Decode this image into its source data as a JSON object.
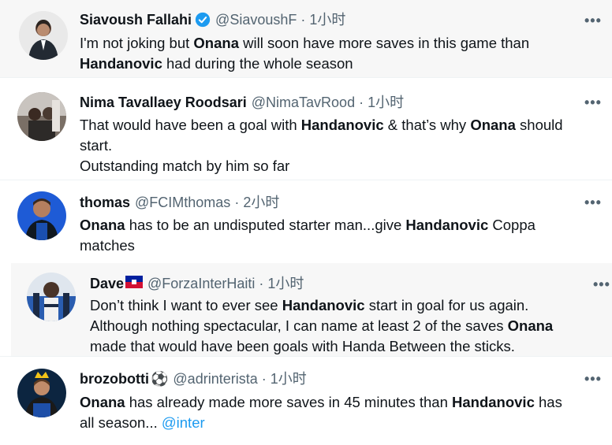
{
  "tweets": [
    {
      "name": "Siavoush Fallahi",
      "handle": "@SiavoushF",
      "time": "1小时",
      "text": {
        "a": "I'm not joking but ",
        "b": "Onana",
        "c": " will soon have more saves in this game than",
        "d": "Handanovic",
        "e": " had during the whole season"
      }
    },
    {
      "name": "Nima Tavallaey Roodsari",
      "handle": "@NimaTavRood",
      "time": "1小时",
      "text": {
        "a": "That would have been a goal with ",
        "b": "Handanovic",
        "c": " & that’s why ",
        "d": "Onana",
        "e": " should",
        "f": "start.",
        "g": "Outstanding match by him so far"
      }
    },
    {
      "name": "thomas",
      "handle": "@FCIMthomas",
      "time": "2小时",
      "text": {
        "a": "Onana",
        "b": " has to be an undisputed starter man...give ",
        "c": "Handanovic",
        "d": " Coppa",
        "e": "matches"
      }
    },
    {
      "name": "Dave",
      "flag": "🇭🇹",
      "handle": "@ForzaInterHaiti",
      "time": "1小时",
      "text": {
        "a": "Don’t think I want to ever see ",
        "b": "Handanovic",
        "c": " start in goal for us again.",
        "d": "Although nothing spectacular, I can name at least 2 of the saves ",
        "e": "Onana",
        "f": "made that would have been goals with Handa Between the sticks."
      }
    },
    {
      "name": "brozobotti",
      "emoji": "⚽",
      "handle": "@adrinterista",
      "time": "1小时",
      "text": {
        "a": "Onana",
        "b": " has already made more saves in 45 minutes than ",
        "c": "Handanovic",
        "d": " has",
        "e": "all season... ",
        "f": "@inter"
      }
    }
  ],
  "ui": {
    "more": "•••",
    "dot": "·"
  },
  "colors": {
    "verified": "#1d9bf0",
    "link": "#1d9bf0",
    "secondary": "#536471"
  }
}
